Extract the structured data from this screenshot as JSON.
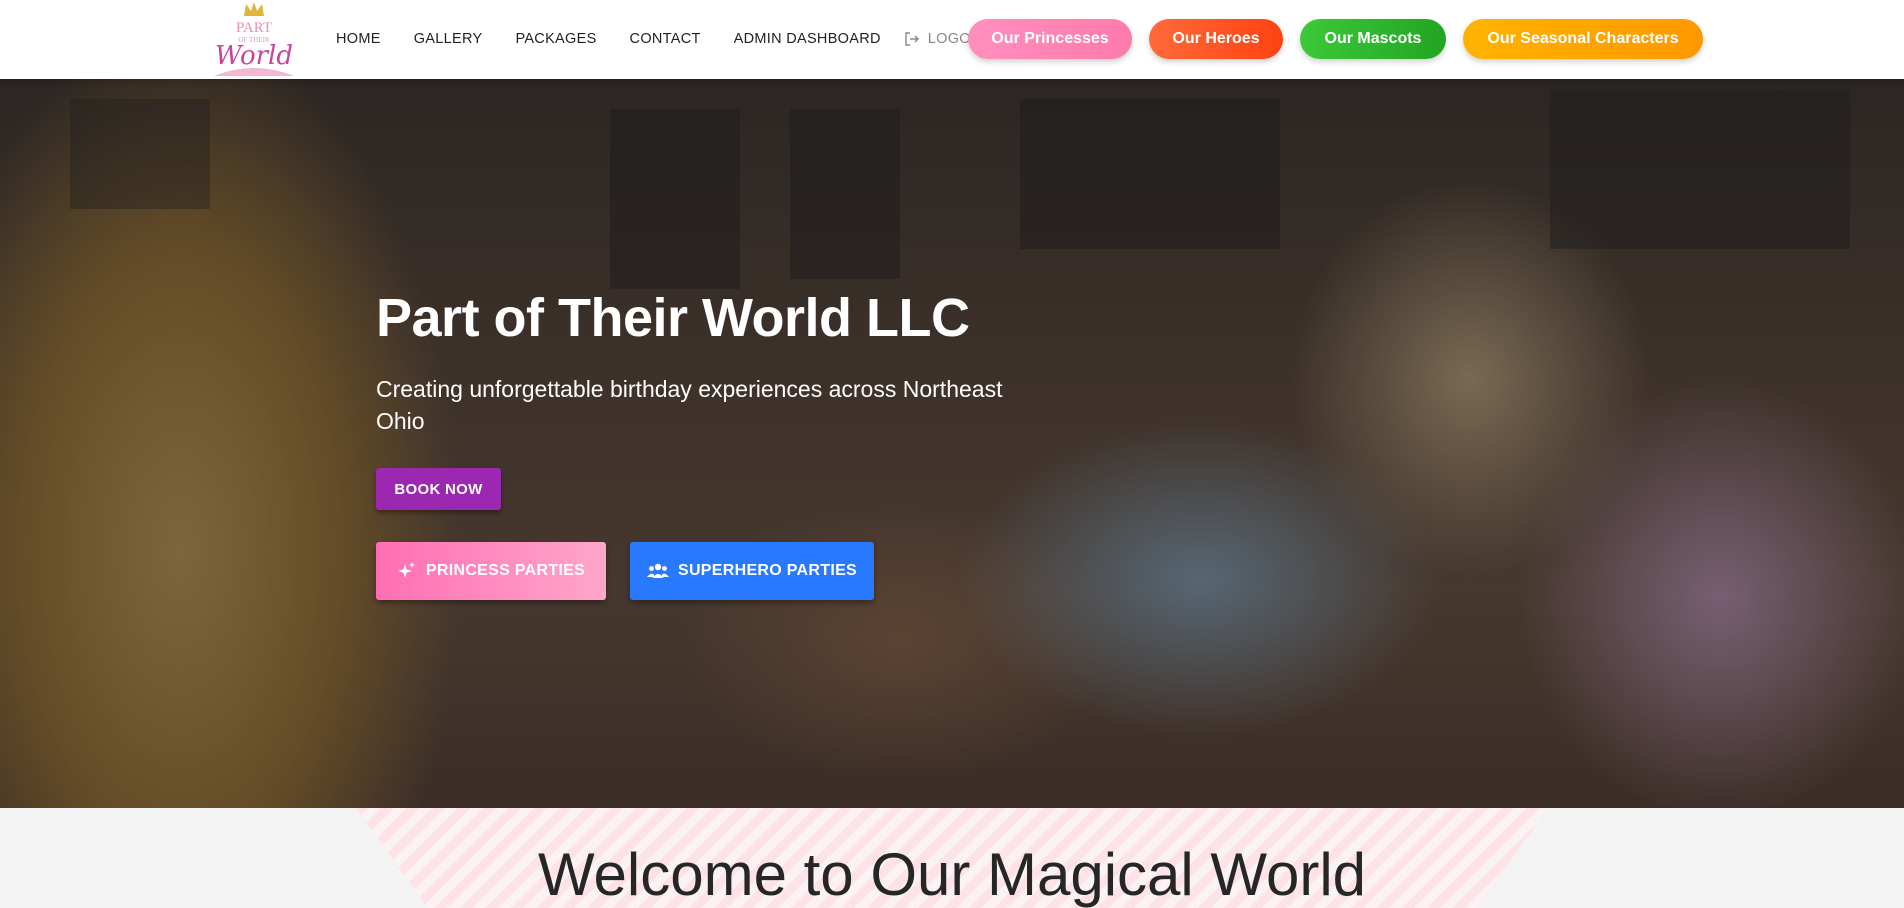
{
  "brand": {
    "logo_line1": "PART",
    "logo_line2": "OF THEIR",
    "logo_line3": "World"
  },
  "nav": {
    "links": [
      "HOME",
      "GALLERY",
      "PACKAGES",
      "CONTACT",
      "ADMIN DASHBOARD"
    ],
    "logout_label": "LOGOUT",
    "logout_icon": "logout-icon"
  },
  "pills": [
    {
      "label": "Our Princesses",
      "color": "#ff82b2"
    },
    {
      "label": "Our Heroes",
      "color": "#ff4f24"
    },
    {
      "label": "Our Mascots",
      "color": "#2db82a"
    },
    {
      "label": "Our Seasonal Characters",
      "color": "#ffa000"
    }
  ],
  "hero": {
    "title": "Part of Their World LLC",
    "subtitle": "Creating unforgettable birthday experiences across Northeast Ohio",
    "book_label": "BOOK NOW",
    "princess_label": "PRINCESS PARTIES",
    "princess_icon": "sparkle-icon",
    "superhero_label": "SUPERHERO PARTIES",
    "superhero_icon": "group-icon"
  },
  "welcome": {
    "title": "Welcome to Our Magical World"
  },
  "colors": {
    "book_button": "#9c27b0",
    "superhero_button": "#2979ff",
    "princess_button_start": "#ff6eb4",
    "princess_button_end": "#ffa6c9"
  }
}
